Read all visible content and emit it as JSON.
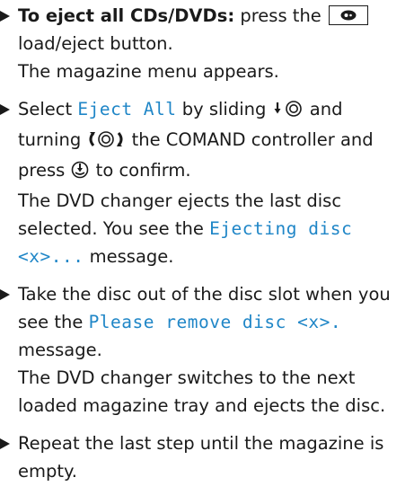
{
  "steps": [
    {
      "lead": "To eject all CDs/DVDs:",
      "text_a": " press the ",
      "line2": "load/eject button.",
      "line3": "The magazine menu appears."
    },
    {
      "select_pre": "Select ",
      "select_item": "Eject All",
      "select_post": " by sliding ",
      "turning_pre": "turning ",
      "turning_post": " the COMAND controller and",
      "press_pre": "press ",
      "press_post": " to confirm.",
      "result1": "The DVD changer ejects the last disc",
      "result2_pre": "selected. You see the ",
      "result2_msg": "Ejecting disc",
      "result3_msg": "<x>...",
      "result3_post": " message."
    },
    {
      "line1": "Take the disc out of the disc slot when you",
      "line2_pre": "see the ",
      "line2_msg": "Please remove disc <x>.",
      "line3": "message.",
      "result1": "The DVD changer switches to the next",
      "result2": "loaded magazine tray and ejects the disc."
    },
    {
      "line1": "Repeat the last step until the magazine is",
      "line2": "empty."
    }
  ],
  "icons": {
    "eject_button": "load-eject-button-icon",
    "slide": "slide-down-controller-icon",
    "turn": "turn-controller-icon",
    "press": "press-controller-icon"
  }
}
